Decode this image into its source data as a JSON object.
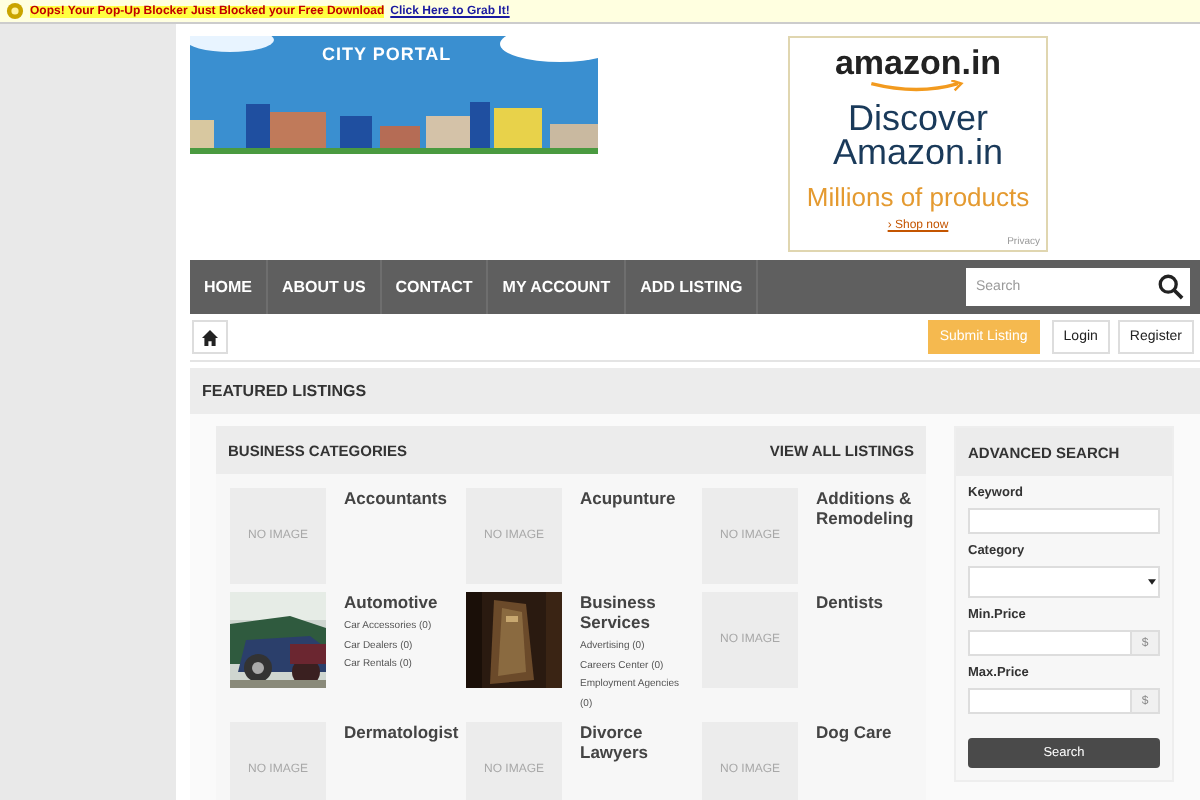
{
  "notice": {
    "message": "Oops! Your Pop-Up Blocker Just Blocked your Free Download",
    "link": "Click Here to Grab It!"
  },
  "banner": {
    "title": "CITY PORTAL"
  },
  "ad": {
    "brand": "amazon.in",
    "headline": "Discover Amazon.in",
    "tagline": "Millions of products",
    "link": "› Shop now",
    "note": "Privacy"
  },
  "nav": {
    "items": [
      "HOME",
      "ABOUT US",
      "CONTACT",
      "MY ACCOUNT",
      "ADD LISTING"
    ],
    "search": {
      "placeholder": "Search"
    }
  },
  "toolbar": {
    "buttons": [
      {
        "label": "Submit Listing",
        "kind": "primary"
      },
      {
        "label": "Login",
        "kind": "plain"
      },
      {
        "label": "Register",
        "kind": "plain"
      }
    ]
  },
  "featured": {
    "title": "FEATURED LISTINGS"
  },
  "categories": {
    "title": "BUSINESS CATEGORIES",
    "link": "VIEW ALL LISTINGS",
    "items": [
      {
        "name": "Accountants",
        "kind": "placeholder",
        "placeholder": "NO IMAGE"
      },
      {
        "name": "Acupunture",
        "kind": "placeholder",
        "placeholder": "NO IMAGE"
      },
      {
        "name": "Additions & Remodeling",
        "kind": "placeholder",
        "placeholder": "NO IMAGE"
      },
      {
        "name": "Automotive",
        "kind": "picture",
        "subcategories": [
          "Car Accessories (0)",
          "Car Dealers (0)",
          "Car Rentals (0)"
        ]
      },
      {
        "name": "Business Services",
        "kind": "picture",
        "subcategories": [
          "Advertising (0)",
          "Careers Center (0)",
          "Employment Agencies (0)"
        ]
      },
      {
        "name": "Dentists",
        "kind": "placeholder",
        "placeholder": "NO IMAGE"
      },
      {
        "name": "Dermatologist",
        "kind": "placeholder",
        "placeholder": "NO IMAGE"
      },
      {
        "name": "Divorce Lawyers",
        "kind": "placeholder",
        "placeholder": "NO IMAGE"
      },
      {
        "name": "Dog Care",
        "kind": "placeholder",
        "placeholder": "NO IMAGE"
      }
    ]
  },
  "advanced_search": {
    "title": "ADVANCED SEARCH",
    "fields": [
      {
        "label": "Keyword",
        "kind": "text"
      },
      {
        "label": "Category",
        "kind": "select"
      },
      {
        "label": "Min.Price",
        "kind": "price",
        "unit": "$"
      },
      {
        "label": "Max.Price",
        "kind": "price",
        "unit": "$"
      }
    ],
    "button": "Search"
  }
}
